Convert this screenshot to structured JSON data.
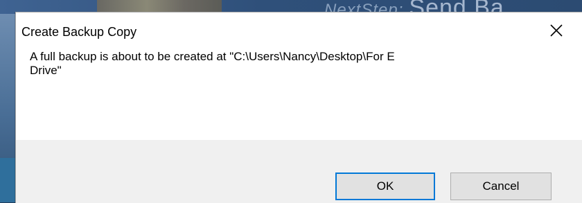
{
  "window": {
    "title": "Create Backup Copy"
  },
  "dialog": {
    "message_line1": "A full backup is about to be created at \"C:\\Users\\Nancy\\Desktop\\For E",
    "message_line2": "Drive\""
  },
  "buttons": {
    "ok": "OK",
    "cancel": "Cancel"
  },
  "background": {
    "text": "NextStep:",
    "text_big": "Send Ba"
  },
  "colors": {
    "accent": "#0078d7",
    "footer_bg": "#f0f0f0",
    "button_bg": "#e1e1e1"
  },
  "icons": {
    "close": "close-icon"
  }
}
